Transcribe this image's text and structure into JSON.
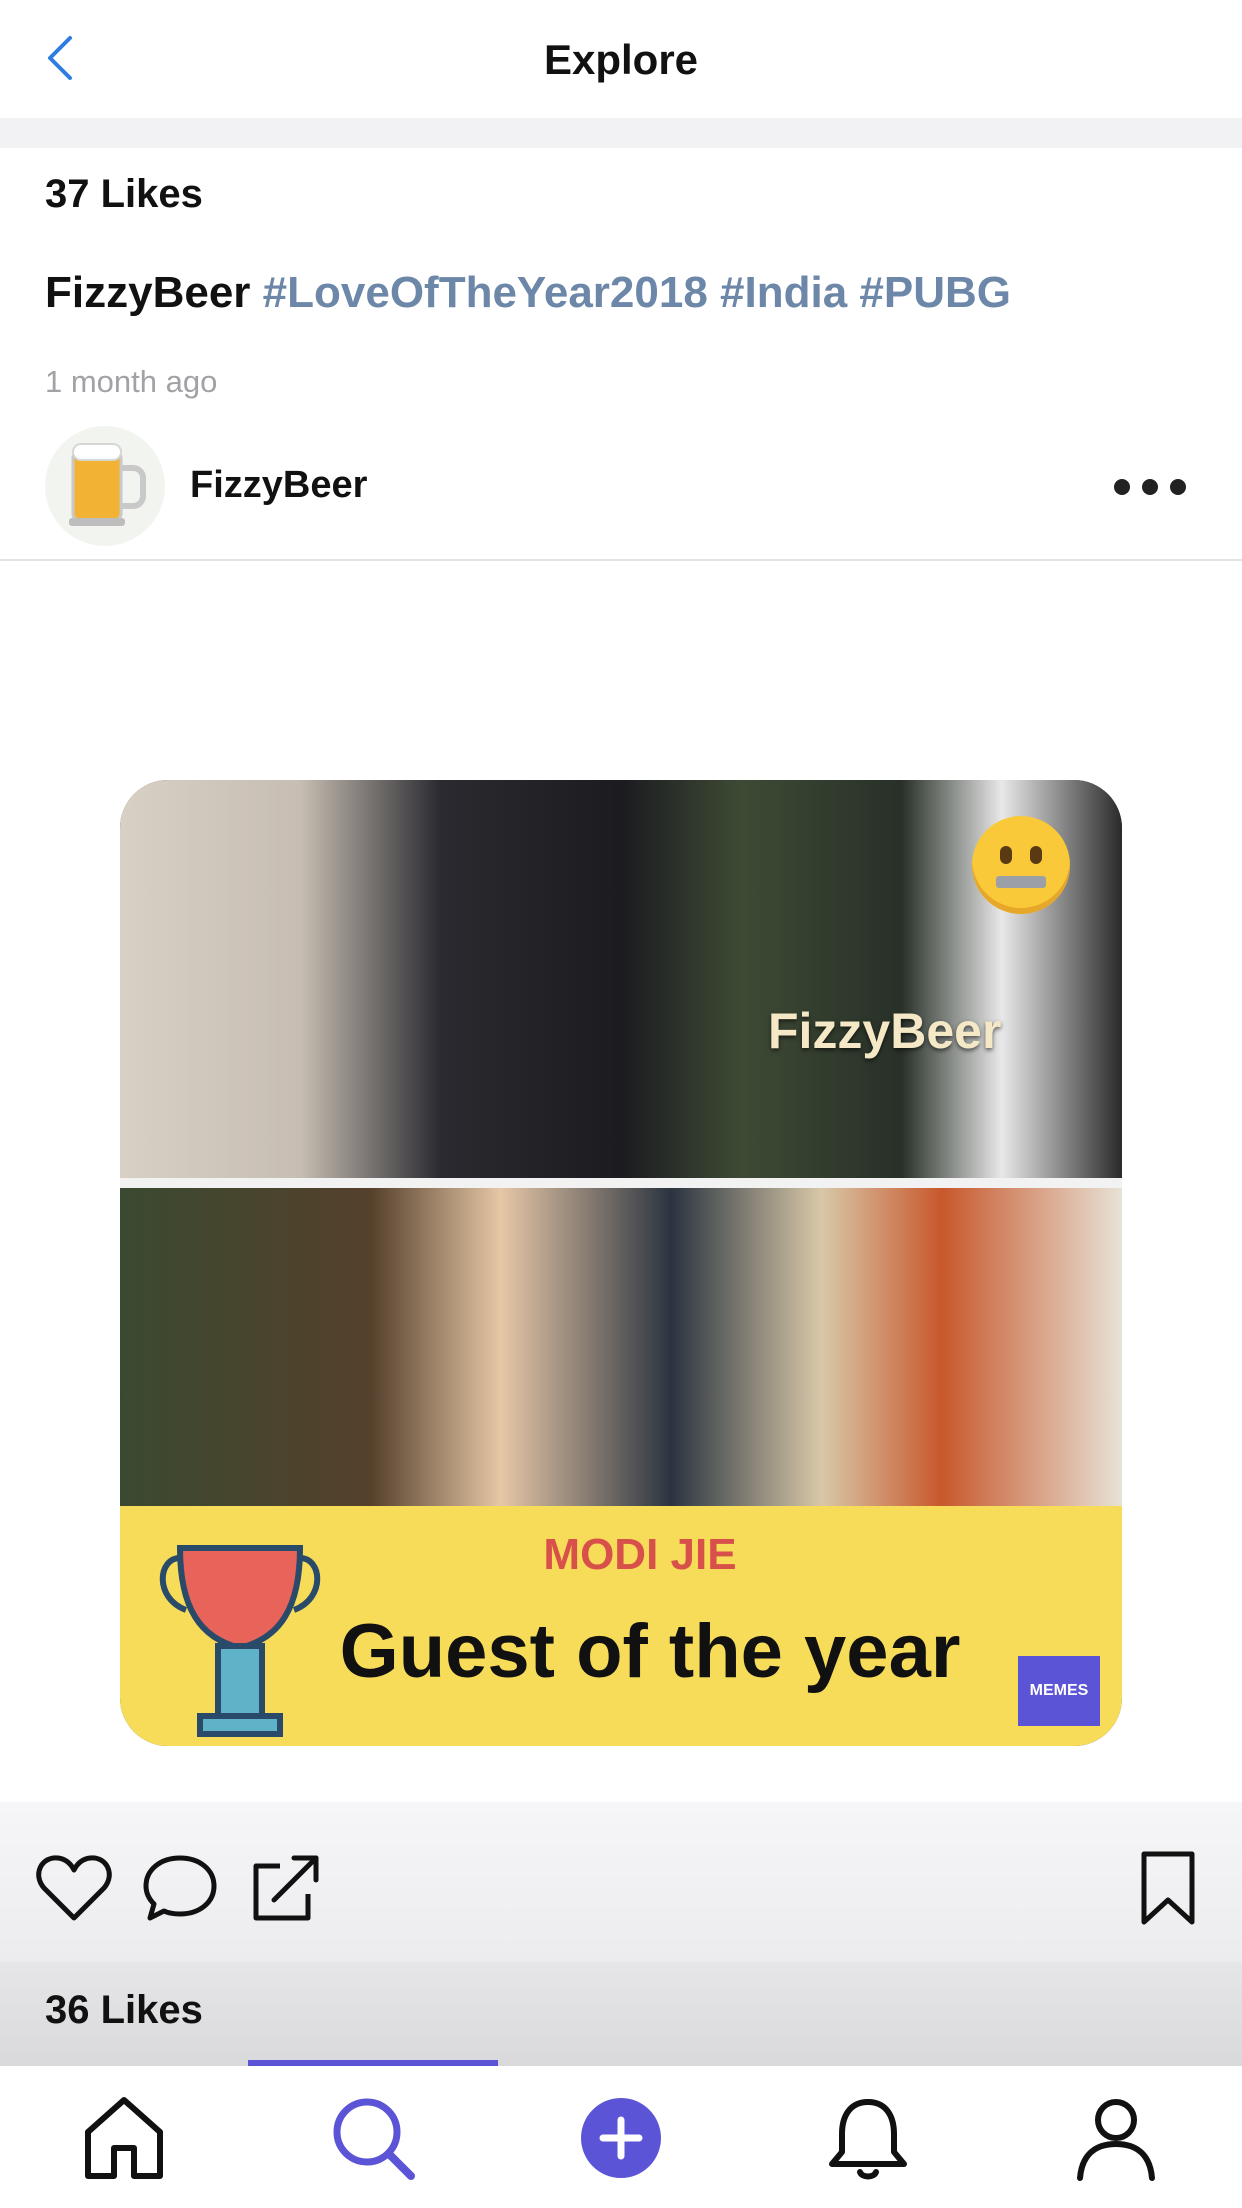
{
  "header": {
    "title": "Explore"
  },
  "previous_post": {
    "likes": "37 Likes"
  },
  "caption": {
    "username": "FizzyBeer",
    "hashtags": [
      "#LoveOfTheYear2018",
      "#India",
      "#PUBG"
    ],
    "time": "1 month ago"
  },
  "post": {
    "username": "FizzyBeer",
    "image_text": {
      "watermark": "FizzyBeer",
      "banner_subtitle": "MODI JIE",
      "banner_title": "Guest of the year",
      "logo_text": "MEMES"
    },
    "likes": "36 Likes"
  },
  "colors": {
    "accent": "#5b54d6",
    "hashtag": "#6c87a8",
    "back_arrow": "#2f7de1",
    "banner": "#f7dc5a"
  },
  "icons": {
    "back": "chevron-left-icon",
    "more": "more-horizontal-icon",
    "like": "heart-icon",
    "comment": "comment-bubble-icon",
    "share": "share-external-icon",
    "bookmark": "bookmark-icon",
    "tabs": [
      "home-icon",
      "search-icon",
      "plus-circle-icon",
      "bell-icon",
      "profile-icon"
    ]
  },
  "tabbar": {
    "active_tab": "search"
  }
}
